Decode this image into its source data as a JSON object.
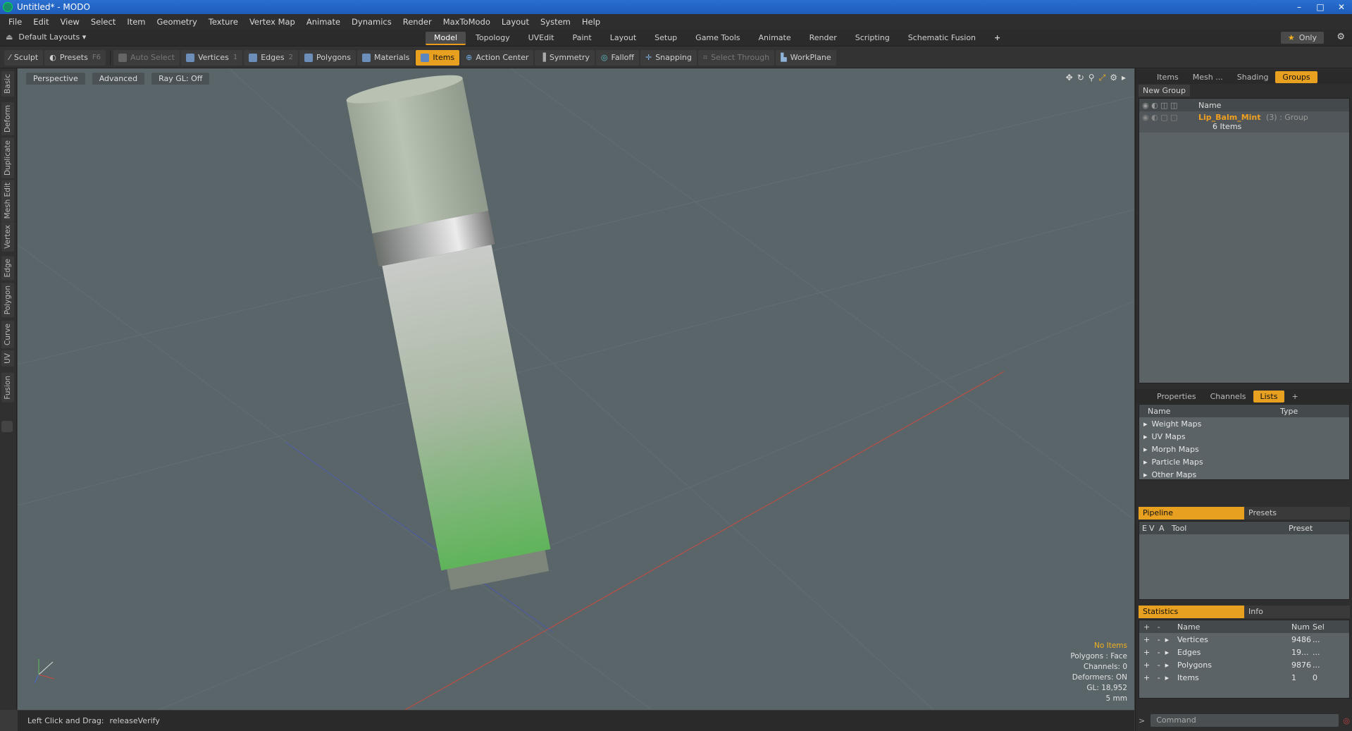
{
  "window": {
    "title": "Untitled* - MODO",
    "minimize": "–",
    "maximize": "□",
    "close": "✕"
  },
  "menu": [
    "File",
    "Edit",
    "View",
    "Select",
    "Item",
    "Geometry",
    "Texture",
    "Vertex Map",
    "Animate",
    "Dynamics",
    "Render",
    "MaxToModo",
    "Layout",
    "System",
    "Help"
  ],
  "layouts": {
    "label": "Default Layouts ▾"
  },
  "tabs": [
    "Model",
    "Topology",
    "UVEdit",
    "Paint",
    "Layout",
    "Setup",
    "Game Tools",
    "Animate",
    "Render",
    "Scripting",
    "Schematic Fusion",
    "+"
  ],
  "active_tab": "Model",
  "only_label": "Only",
  "toolbar": {
    "sculpt": "Sculpt",
    "presets": "Presets",
    "presets_key": "F6",
    "auto_select": "Auto Select",
    "vertices": "Vertices",
    "vertices_key": "1",
    "edges": "Edges",
    "edges_key": "2",
    "polygons": "Polygons",
    "materials": "Materials",
    "items": "Items",
    "action_center": "Action Center",
    "symmetry": "Symmetry",
    "falloff": "Falloff",
    "snapping": "Snapping",
    "select_through": "Select Through",
    "workplane": "WorkPlane"
  },
  "left_tabs": [
    "Basic",
    "Deform",
    "Duplicate",
    "Mesh Edit",
    "Vertex",
    "Edge",
    "Polygon",
    "Curve",
    "UV",
    "Fusion"
  ],
  "viewport": {
    "view": "Perspective",
    "shading": "Advanced",
    "raygl": "Ray GL: Off",
    "info": {
      "no_items": "No Items",
      "polygons": "Polygons : Face",
      "channels": "Channels: 0",
      "deformers": "Deformers: ON",
      "gl": "GL: 18,952",
      "scale": "5 mm"
    }
  },
  "status": {
    "hint": "Left Click and Drag:",
    "action": "releaseVerify"
  },
  "groups_panel": {
    "tabs": [
      "Items",
      "Mesh ...",
      "Shading",
      "Groups"
    ],
    "active": "Groups",
    "new_group": "New Group",
    "col_name": "Name",
    "group_name": "Lip_Balm_Mint",
    "group_suffix": "(3) : Group",
    "group_items": "6 Items"
  },
  "lists_panel": {
    "tabs": [
      "Properties",
      "Channels",
      "Lists",
      "+"
    ],
    "active": "Lists",
    "col_name": "Name",
    "col_type": "Type",
    "rows": [
      "Weight Maps",
      "UV Maps",
      "Morph Maps",
      "Particle Maps",
      "Other Maps"
    ]
  },
  "pipeline_panel": {
    "tabs": [
      "Pipeline",
      "Presets"
    ],
    "cols": [
      "E",
      "V",
      "A",
      "Tool",
      "Preset"
    ]
  },
  "stats_panel": {
    "tabs": [
      "Statistics",
      "Info"
    ],
    "cols": [
      "Name",
      "Num",
      "Sel"
    ],
    "rows": [
      {
        "name": "Vertices",
        "num": "9486",
        "sel": "..."
      },
      {
        "name": "Edges",
        "num": "19...",
        "sel": "..."
      },
      {
        "name": "Polygons",
        "num": "9876",
        "sel": "..."
      },
      {
        "name": "Items",
        "num": "1",
        "sel": "0"
      }
    ]
  },
  "command": {
    "placeholder": "Command"
  }
}
